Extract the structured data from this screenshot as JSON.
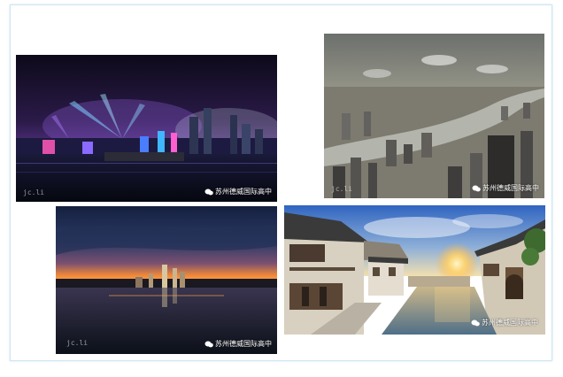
{
  "watermark": {
    "text": "苏州德威国际高中",
    "icon": "wechat-icon"
  },
  "signature": "jc.li",
  "photos": [
    {
      "name": "night-skyline-light-show",
      "sky_top": "#1a1030",
      "sky_mid": "#5a2a8a",
      "accent": "#3fb6ff",
      "water": "#0b0f1c"
    },
    {
      "name": "aerial-river-city",
      "sky_top": "#7a7e78",
      "haze": "#c9c2a8",
      "river": "#b4b8b2",
      "city": "#4b4a48"
    },
    {
      "name": "sunset-lake-skyline",
      "sky_top": "#1b2a55",
      "glow": "#f08a3a",
      "water": "#101826"
    },
    {
      "name": "water-town-canal",
      "sky": "#3f74c9",
      "sun": "#ffd36a",
      "canal": "#6b8fa8",
      "walls": "#d9d2c4"
    }
  ]
}
